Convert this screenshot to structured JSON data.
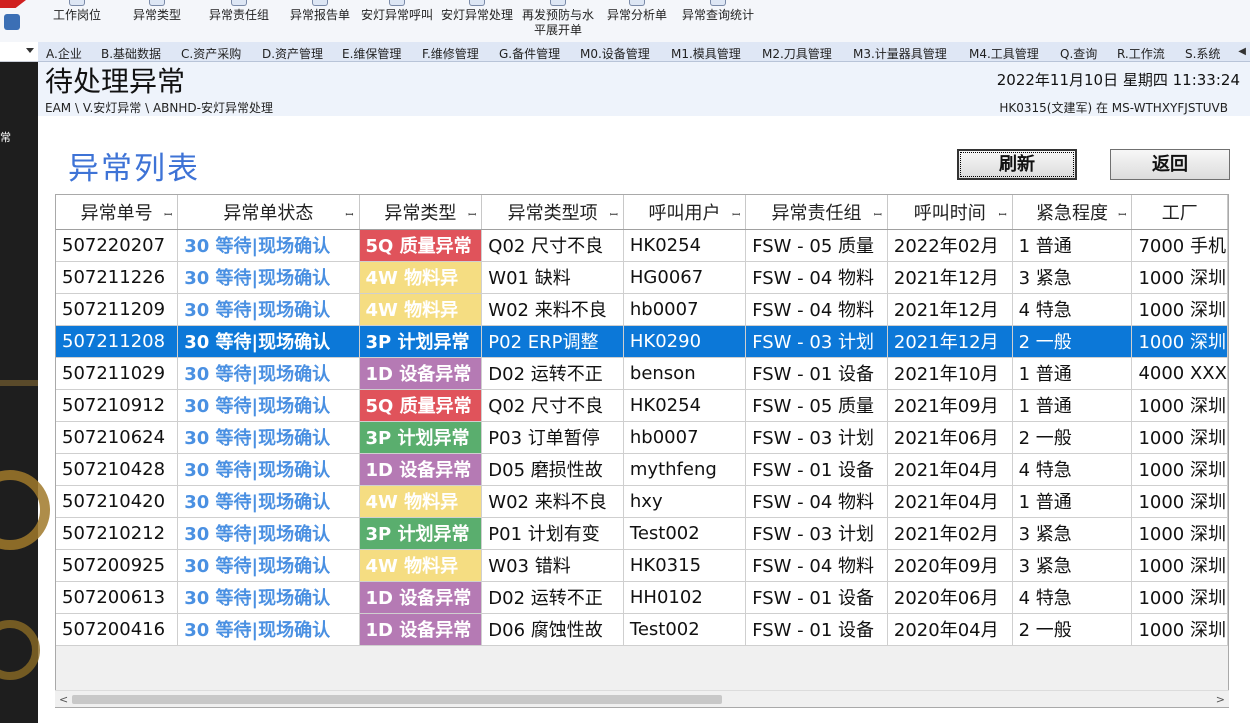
{
  "colors": {
    "accent_title": "#3e73d6",
    "status_text": "#4a90e2",
    "selected_row": "#0c78d8",
    "type_5q": "#e0535b",
    "type_4w": "#f5dd82",
    "type_3p": "#5aae6e",
    "type_1d": "#b57ab4",
    "type_3p_selected": "#0c78d8"
  },
  "toolbar": {
    "items": [
      {
        "label": "工作岗位",
        "icon": "briefcase-icon"
      },
      {
        "label": "异常类型",
        "icon": "category-icon"
      },
      {
        "label": "异常责任组",
        "icon": "group-icon"
      },
      {
        "label": "异常报告单",
        "icon": "report-icon"
      },
      {
        "label": "安灯异常呼叫",
        "icon": "andon-call-icon"
      },
      {
        "label": "安灯异常处理",
        "icon": "andon-handle-icon"
      },
      {
        "label": "再发预防与水\n平展开单",
        "icon": "prevention-icon"
      },
      {
        "label": "异常分析单",
        "icon": "analysis-icon"
      },
      {
        "label": "异常查询统计",
        "icon": "statistics-icon"
      }
    ]
  },
  "menu": {
    "items": [
      "A.企业",
      "B.基础数据",
      "C.资产采购",
      "D.资产管理",
      "E.维保管理",
      "F.维修管理",
      "G.备件管理",
      "M0.设备管理",
      "M1.模具管理",
      "M2.刀具管理",
      "M3.计量器具管理",
      "M4.工具管理",
      "Q.查询",
      "R.工作流",
      "S.系统"
    ]
  },
  "header": {
    "title": "待处理异常",
    "breadcrumb": "EAM \\ V.安灯异常 \\ ABNHD-安灯异常处理",
    "datetime": "2022年11月10日 星期四 11:33:24",
    "user": "HK0315(文建军) 在 MS-WTHXYFJSTUVB"
  },
  "sidebar": {
    "label": "常"
  },
  "list": {
    "title": "异常列表",
    "refresh_label": "刷新",
    "back_label": "返回"
  },
  "table": {
    "columns": [
      "异常单号",
      "异常单状态",
      "异常类型",
      "异常类型项",
      "呼叫用户",
      "异常责任组",
      "呼叫时间",
      "紧急程度",
      "工厂"
    ],
    "rows": [
      {
        "id": "507220207",
        "status": "30 等待|现场确认",
        "type": "5Q 质量异常",
        "type_code": "5Q",
        "item": "Q02 尺寸不良",
        "user": "HK0254",
        "group": "FSW - 05 质量",
        "time": "2022年02月",
        "urgency": "1 普通",
        "factory": "7000 手机"
      },
      {
        "id": "507211226",
        "status": "30 等待|现场确认",
        "type": "4W 物料异",
        "type_code": "4W",
        "item": "W01 缺料",
        "user": "HG0067",
        "group": "FSW - 04 物料",
        "time": "2021年12月",
        "urgency": "3 紧急",
        "factory": "1000 深圳"
      },
      {
        "id": "507211209",
        "status": "30 等待|现场确认",
        "type": "4W 物料异",
        "type_code": "4W",
        "item": "W02 来料不良",
        "user": "hb0007",
        "group": "FSW - 04 物料",
        "time": "2021年12月",
        "urgency": "4 特急",
        "factory": "1000 深圳"
      },
      {
        "id": "507211208",
        "status": "30 等待|现场确认",
        "type": "3P 计划异常",
        "type_code": "3P",
        "item": "P02 ERP调整",
        "user": "HK0290",
        "group": "FSW - 03 计划",
        "time": "2021年12月",
        "urgency": "2 一般",
        "factory": "1000 深圳",
        "selected": true
      },
      {
        "id": "507211029",
        "status": "30 等待|现场确认",
        "type": "1D 设备异常",
        "type_code": "1D",
        "item": "D02 运转不正",
        "user": "benson",
        "group": "FSW - 01 设备",
        "time": "2021年10月",
        "urgency": "1 普通",
        "factory": "4000 XXX"
      },
      {
        "id": "507210912",
        "status": "30 等待|现场确认",
        "type": "5Q 质量异常",
        "type_code": "5Q",
        "item": "Q02 尺寸不良",
        "user": "HK0254",
        "group": "FSW - 05 质量",
        "time": "2021年09月",
        "urgency": "1 普通",
        "factory": "1000 深圳"
      },
      {
        "id": "507210624",
        "status": "30 等待|现场确认",
        "type": "3P 计划异常",
        "type_code": "3P",
        "item": "P03 订单暂停",
        "user": "hb0007",
        "group": "FSW - 03 计划",
        "time": "2021年06月",
        "urgency": "2 一般",
        "factory": "1000 深圳"
      },
      {
        "id": "507210428",
        "status": "30 等待|现场确认",
        "type": "1D 设备异常",
        "type_code": "1D",
        "item": "D05 磨损性故",
        "user": "mythfeng",
        "group": "FSW - 01 设备",
        "time": "2021年04月",
        "urgency": "4 特急",
        "factory": "1000 深圳"
      },
      {
        "id": "507210420",
        "status": "30 等待|现场确认",
        "type": "4W 物料异",
        "type_code": "4W",
        "item": "W02 来料不良",
        "user": "hxy",
        "group": "FSW - 04 物料",
        "time": "2021年04月",
        "urgency": "1 普通",
        "factory": "1000 深圳"
      },
      {
        "id": "507210212",
        "status": "30 等待|现场确认",
        "type": "3P 计划异常",
        "type_code": "3P",
        "item": "P01 计划有变",
        "user": "Test002",
        "group": "FSW - 03 计划",
        "time": "2021年02月",
        "urgency": "3 紧急",
        "factory": "1000 深圳"
      },
      {
        "id": "507200925",
        "status": "30 等待|现场确认",
        "type": "4W 物料异",
        "type_code": "4W",
        "item": "W03 错料",
        "user": "HK0315",
        "group": "FSW - 04 物料",
        "time": "2020年09月",
        "urgency": "3 紧急",
        "factory": "1000 深圳"
      },
      {
        "id": "507200613",
        "status": "30 等待|现场确认",
        "type": "1D 设备异常",
        "type_code": "1D",
        "item": "D02 运转不正",
        "user": "HH0102",
        "group": "FSW - 01 设备",
        "time": "2020年06月",
        "urgency": "4 特急",
        "factory": "1000 深圳"
      },
      {
        "id": "507200416",
        "status": "30 等待|现场确认",
        "type": "1D 设备异常",
        "type_code": "1D",
        "item": "D06 腐蚀性故",
        "user": "Test002",
        "group": "FSW - 01 设备",
        "time": "2020年04月",
        "urgency": "2 一般",
        "factory": "1000 深圳"
      }
    ]
  }
}
